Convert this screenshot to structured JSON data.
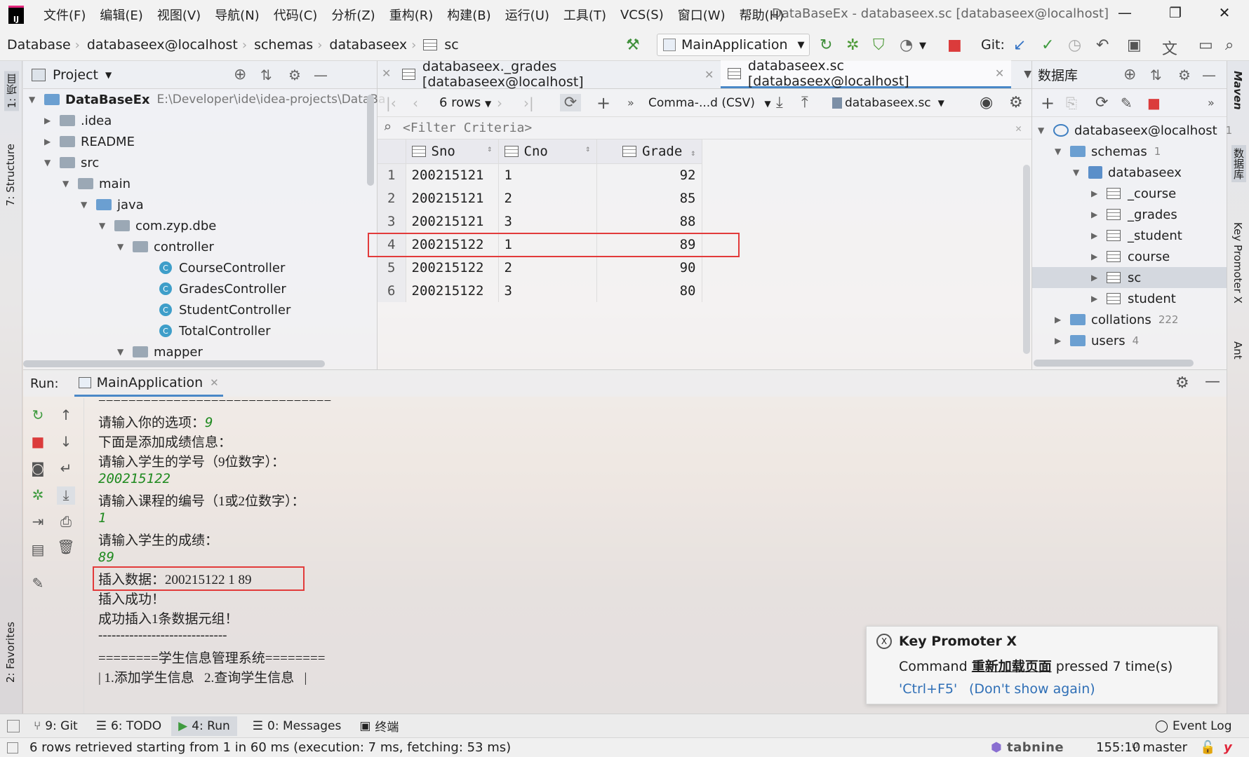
{
  "title_bar": {
    "menus": [
      "文件(F)",
      "编辑(E)",
      "视图(V)",
      "导航(N)",
      "代码(C)",
      "分析(Z)",
      "重构(R)",
      "构建(B)",
      "运行(U)",
      "工具(T)",
      "VCS(S)",
      "窗口(W)",
      "帮助(H)"
    ],
    "window_title": "DataBaseEx - databaseex.sc [databaseex@localhost]"
  },
  "nav_bar": {
    "breadcrumbs": [
      "Database",
      "databaseex@localhost",
      "schemas",
      "databaseex",
      "sc"
    ],
    "run_config": "MainApplication",
    "git_label": "Git:"
  },
  "left_strip": {
    "project_tab": "1: 项目",
    "structure_tab": "7: Structure",
    "favorites_tab": "2: Favorites"
  },
  "right_strip": {
    "maven_tab": "Maven",
    "database_tab": "数据库",
    "key_promoter_tab": "Key Promoter X",
    "ant_tab": "Ant"
  },
  "project_panel": {
    "title": "Project",
    "root_name": "DataBaseEx",
    "root_path": "E:\\Developer\\ide\\idea-projects\\DataBa",
    "items": [
      ".idea",
      "README",
      "src",
      "main",
      "java",
      "com.zyp.dbe",
      "controller",
      "CourseController",
      "GradesController",
      "StudentController",
      "TotalController",
      "mapper"
    ]
  },
  "editor": {
    "tabs": [
      "databaseex._grades [databaseex@localhost]",
      "databaseex.sc [databaseex@localhost]"
    ],
    "rows_label": "6 rows",
    "export_format": "Comma-...d (CSV)",
    "schema_select": "databaseex.sc",
    "filter_placeholder": "<Filter Criteria>",
    "columns": [
      "Sno",
      "Cno",
      "Grade"
    ],
    "rows": [
      [
        "1",
        "200215121",
        "1",
        "92"
      ],
      [
        "2",
        "200215121",
        "2",
        "85"
      ],
      [
        "3",
        "200215121",
        "3",
        "88"
      ],
      [
        "4",
        "200215122",
        "1",
        "89"
      ],
      [
        "5",
        "200215122",
        "2",
        "90"
      ],
      [
        "6",
        "200215122",
        "3",
        "80"
      ]
    ]
  },
  "db_panel": {
    "title": "数据库",
    "connection": "databaseex@localhost",
    "connection_count": "1",
    "schemas_label": "schemas",
    "schemas_count": "1",
    "schema_name": "databaseex",
    "tables": [
      "_course",
      "_grades",
      "_student",
      "course",
      "sc",
      "student"
    ],
    "collations_label": "collations",
    "collations_count": "222",
    "users_label": "users",
    "users_count": "4"
  },
  "run_panel": {
    "label": "Run:",
    "tab": "MainApplication",
    "console": [
      {
        "text": "===============================",
        "type": "out"
      },
      {
        "text": "请输入你的选项：",
        "type": "out",
        "inline_input": "9"
      },
      {
        "text": "下面是添加成绩信息：",
        "type": "out"
      },
      {
        "text": "请输入学生的学号（9位数字）：",
        "type": "out"
      },
      {
        "text": "200215122",
        "type": "in"
      },
      {
        "text": "请输入课程的编号（1或2位数字）：",
        "type": "out"
      },
      {
        "text": "1",
        "type": "in"
      },
      {
        "text": "请输入学生的成绩：",
        "type": "out"
      },
      {
        "text": "89",
        "type": "in"
      },
      {
        "text": "插入数据：200215122 1 89",
        "type": "out"
      },
      {
        "text": "插入成功！",
        "type": "out"
      },
      {
        "text": "成功插入1条数据元组！",
        "type": "out"
      },
      {
        "text": "-----------------------------",
        "type": "out"
      },
      {
        "text": "========学生信息管理系统========",
        "type": "out"
      },
      {
        "text": "| 1.添加学生信息   2.查询学生信息   |",
        "type": "out"
      }
    ]
  },
  "notification": {
    "title": "Key Promoter X",
    "line_prefix": "Command",
    "command": "重新加载页面",
    "line_suffix": "pressed 7 time(s)",
    "shortcut": "'Ctrl+F5'",
    "dismiss": "(Don't show again)"
  },
  "bottom_tabs": {
    "git": "9: Git",
    "todo": "6: TODO",
    "run": "4: Run",
    "messages": "0: Messages",
    "terminal": "终端",
    "event_log": "Event Log"
  },
  "status_bar": {
    "message": "6 rows retrieved starting from 1 in 60 ms (execution: 7 ms, fetching: 53 ms)",
    "plugin": "tabnine",
    "position": "155:10",
    "branch": "master"
  },
  "colors": {
    "highlight_box": "#e23b3b",
    "console_input": "#1f8a1f",
    "accent_tab": "#4a88c7"
  }
}
